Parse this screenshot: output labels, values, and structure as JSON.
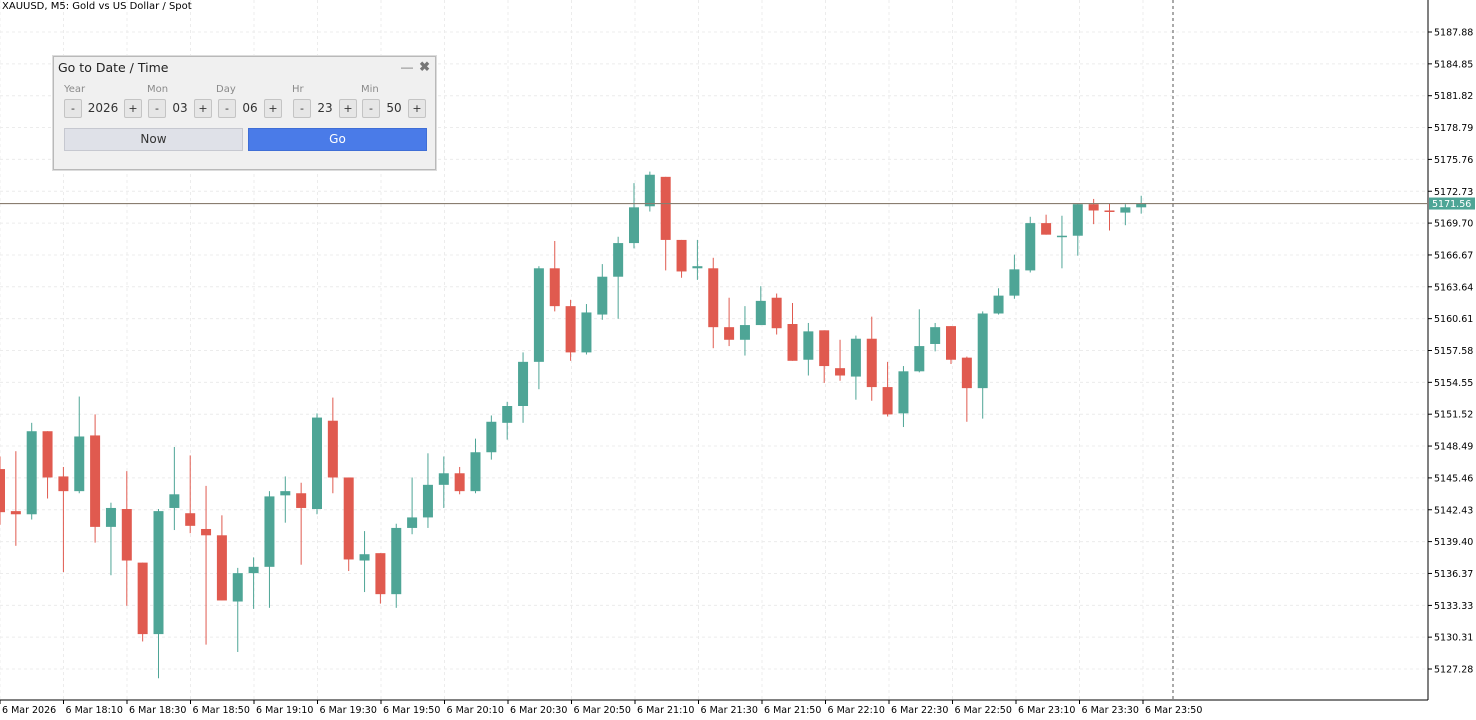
{
  "chart": {
    "title": "XAUUSD, M5:  Gold vs US Dollar / Spot",
    "current_price_label": "5171.56",
    "price_line_color": "#8a7e70",
    "bull_color": "#4ea596",
    "bear_color": "#e05a4f",
    "price_tag_color": "#4ea596"
  },
  "dialog": {
    "title": "Go to Date / Time",
    "minimize_icon": "minimize-icon",
    "close_icon": "close-icon",
    "fields": [
      {
        "label": "Year",
        "value": "2026",
        "dec": "-",
        "inc": "+"
      },
      {
        "label": "Mon",
        "value": "03",
        "dec": "-",
        "inc": "+"
      },
      {
        "label": "Day",
        "value": "06",
        "dec": "-",
        "inc": "+"
      },
      {
        "label": "Hr",
        "value": "23",
        "dec": "-",
        "inc": "+"
      },
      {
        "label": "Min",
        "value": "50",
        "dec": "-",
        "inc": "+"
      }
    ],
    "now_label": "Now",
    "go_label": "Go"
  },
  "chart_data": {
    "type": "candlestick",
    "y_ticks": [
      5187.88,
      5184.85,
      5181.82,
      5178.79,
      5175.76,
      5172.73,
      5169.7,
      5166.67,
      5163.64,
      5160.61,
      5157.58,
      5154.55,
      5151.52,
      5148.49,
      5145.46,
      5142.43,
      5139.4,
      5136.37,
      5133.33,
      5130.31,
      5127.28
    ],
    "x_tick_labels": [
      "6 Mar 2026",
      "6 Mar 18:10",
      "6 Mar 18:30",
      "6 Mar 18:50",
      "6 Mar 19:10",
      "6 Mar 19:30",
      "6 Mar 19:50",
      "6 Mar 20:10",
      "6 Mar 20:30",
      "6 Mar 20:50",
      "6 Mar 21:10",
      "6 Mar 21:30",
      "6 Mar 21:50",
      "6 Mar 22:10",
      "6 Mar 22:30",
      "6 Mar 22:50",
      "6 Mar 23:10",
      "6 Mar 23:30",
      "6 Mar 23:50"
    ],
    "ylim": [
      5124.8,
      5190.5
    ],
    "current_price": 5171.56,
    "grid": true,
    "candles": [
      {
        "o": 5146.3,
        "h": 5147.5,
        "l": 5141.0,
        "c": 5142.2
      },
      {
        "o": 5142.3,
        "h": 5148.0,
        "l": 5139.0,
        "c": 5142.0
      },
      {
        "o": 5142.0,
        "h": 5150.7,
        "l": 5141.5,
        "c": 5149.9
      },
      {
        "o": 5149.9,
        "h": 5149.9,
        "l": 5143.5,
        "c": 5145.5
      },
      {
        "o": 5145.6,
        "h": 5146.5,
        "l": 5136.5,
        "c": 5144.2
      },
      {
        "o": 5144.2,
        "h": 5153.2,
        "l": 5144.0,
        "c": 5149.4
      },
      {
        "o": 5149.5,
        "h": 5151.5,
        "l": 5139.3,
        "c": 5140.8
      },
      {
        "o": 5140.8,
        "h": 5143.1,
        "l": 5136.2,
        "c": 5142.6
      },
      {
        "o": 5142.5,
        "h": 5146.1,
        "l": 5133.3,
        "c": 5137.6
      },
      {
        "o": 5137.4,
        "h": 5137.4,
        "l": 5129.9,
        "c": 5130.6
      },
      {
        "o": 5130.6,
        "h": 5142.5,
        "l": 5126.4,
        "c": 5142.3
      },
      {
        "o": 5142.6,
        "h": 5148.4,
        "l": 5140.5,
        "c": 5143.9
      },
      {
        "o": 5142.1,
        "h": 5147.6,
        "l": 5140.2,
        "c": 5140.9
      },
      {
        "o": 5140.6,
        "h": 5144.7,
        "l": 5129.6,
        "c": 5140.0
      },
      {
        "o": 5140.0,
        "h": 5141.9,
        "l": 5133.8,
        "c": 5133.8
      },
      {
        "o": 5133.7,
        "h": 5136.9,
        "l": 5128.9,
        "c": 5136.4
      },
      {
        "o": 5136.4,
        "h": 5137.9,
        "l": 5133.0,
        "c": 5137.0
      },
      {
        "o": 5137.0,
        "h": 5144.2,
        "l": 5133.1,
        "c": 5143.7
      },
      {
        "o": 5143.8,
        "h": 5145.6,
        "l": 5141.2,
        "c": 5144.2
      },
      {
        "o": 5144.0,
        "h": 5145.0,
        "l": 5137.2,
        "c": 5142.6
      },
      {
        "o": 5142.5,
        "h": 5151.6,
        "l": 5142.0,
        "c": 5151.2
      },
      {
        "o": 5150.9,
        "h": 5153.1,
        "l": 5144.0,
        "c": 5145.5
      },
      {
        "o": 5145.5,
        "h": 5145.5,
        "l": 5136.6,
        "c": 5137.7
      },
      {
        "o": 5137.6,
        "h": 5140.4,
        "l": 5134.6,
        "c": 5138.2
      },
      {
        "o": 5138.3,
        "h": 5138.3,
        "l": 5133.5,
        "c": 5134.4
      },
      {
        "o": 5134.4,
        "h": 5141.1,
        "l": 5133.1,
        "c": 5140.7
      },
      {
        "o": 5140.7,
        "h": 5145.5,
        "l": 5140.1,
        "c": 5141.7
      },
      {
        "o": 5141.7,
        "h": 5147.8,
        "l": 5140.7,
        "c": 5144.8
      },
      {
        "o": 5144.8,
        "h": 5147.5,
        "l": 5142.6,
        "c": 5145.9
      },
      {
        "o": 5145.9,
        "h": 5146.5,
        "l": 5143.9,
        "c": 5144.2
      },
      {
        "o": 5144.2,
        "h": 5149.2,
        "l": 5144.0,
        "c": 5147.9
      },
      {
        "o": 5147.9,
        "h": 5151.4,
        "l": 5147.2,
        "c": 5150.8
      },
      {
        "o": 5150.7,
        "h": 5152.7,
        "l": 5149.1,
        "c": 5152.3
      },
      {
        "o": 5152.3,
        "h": 5157.4,
        "l": 5150.7,
        "c": 5156.5
      },
      {
        "o": 5156.5,
        "h": 5165.6,
        "l": 5153.9,
        "c": 5165.4
      },
      {
        "o": 5165.4,
        "h": 5168.0,
        "l": 5161.3,
        "c": 5161.8
      },
      {
        "o": 5161.8,
        "h": 5162.4,
        "l": 5156.6,
        "c": 5157.4
      },
      {
        "o": 5157.4,
        "h": 5162.0,
        "l": 5157.2,
        "c": 5161.2
      },
      {
        "o": 5161.0,
        "h": 5165.8,
        "l": 5160.5,
        "c": 5164.6
      },
      {
        "o": 5164.6,
        "h": 5168.4,
        "l": 5160.6,
        "c": 5167.8
      },
      {
        "o": 5167.8,
        "h": 5173.5,
        "l": 5167.3,
        "c": 5171.2
      },
      {
        "o": 5171.3,
        "h": 5174.6,
        "l": 5170.8,
        "c": 5174.3
      },
      {
        "o": 5174.1,
        "h": 5174.1,
        "l": 5165.2,
        "c": 5168.1
      },
      {
        "o": 5168.1,
        "h": 5168.1,
        "l": 5164.5,
        "c": 5165.1
      },
      {
        "o": 5165.4,
        "h": 5168.1,
        "l": 5164.3,
        "c": 5165.6
      },
      {
        "o": 5165.4,
        "h": 5166.4,
        "l": 5157.8,
        "c": 5159.8
      },
      {
        "o": 5159.8,
        "h": 5162.6,
        "l": 5158.0,
        "c": 5158.6
      },
      {
        "o": 5158.6,
        "h": 5161.8,
        "l": 5157.1,
        "c": 5160.0
      },
      {
        "o": 5160.0,
        "h": 5163.7,
        "l": 5160.0,
        "c": 5162.3
      },
      {
        "o": 5162.6,
        "h": 5163.0,
        "l": 5159.1,
        "c": 5159.7
      },
      {
        "o": 5160.1,
        "h": 5162.1,
        "l": 5156.6,
        "c": 5156.6
      },
      {
        "o": 5156.7,
        "h": 5160.2,
        "l": 5155.2,
        "c": 5159.4
      },
      {
        "o": 5159.5,
        "h": 5159.5,
        "l": 5154.5,
        "c": 5156.1
      },
      {
        "o": 5155.9,
        "h": 5158.6,
        "l": 5154.7,
        "c": 5155.2
      },
      {
        "o": 5155.1,
        "h": 5159.0,
        "l": 5152.9,
        "c": 5158.7
      },
      {
        "o": 5158.7,
        "h": 5160.8,
        "l": 5152.8,
        "c": 5154.1
      },
      {
        "o": 5154.1,
        "h": 5156.5,
        "l": 5151.3,
        "c": 5151.5
      },
      {
        "o": 5151.6,
        "h": 5156.1,
        "l": 5150.3,
        "c": 5155.6
      },
      {
        "o": 5155.6,
        "h": 5161.5,
        "l": 5155.5,
        "c": 5158.0
      },
      {
        "o": 5158.2,
        "h": 5160.2,
        "l": 5157.5,
        "c": 5159.8
      },
      {
        "o": 5159.9,
        "h": 5159.9,
        "l": 5156.3,
        "c": 5156.7
      },
      {
        "o": 5156.9,
        "h": 5157.0,
        "l": 5150.8,
        "c": 5154.0
      },
      {
        "o": 5154.0,
        "h": 5161.3,
        "l": 5151.1,
        "c": 5161.1
      },
      {
        "o": 5161.1,
        "h": 5163.5,
        "l": 5161.0,
        "c": 5162.8
      },
      {
        "o": 5162.8,
        "h": 5166.7,
        "l": 5162.5,
        "c": 5165.3
      },
      {
        "o": 5165.2,
        "h": 5170.3,
        "l": 5165.0,
        "c": 5169.7
      },
      {
        "o": 5169.7,
        "h": 5170.5,
        "l": 5168.6,
        "c": 5168.6
      },
      {
        "o": 5168.5,
        "h": 5170.4,
        "l": 5165.4,
        "c": 5168.5
      },
      {
        "o": 5168.5,
        "h": 5171.6,
        "l": 5166.6,
        "c": 5171.5
      },
      {
        "o": 5171.5,
        "h": 5172.0,
        "l": 5169.6,
        "c": 5170.9
      },
      {
        "o": 5170.9,
        "h": 5171.6,
        "l": 5169.0,
        "c": 5170.8
      },
      {
        "o": 5170.7,
        "h": 5171.5,
        "l": 5169.5,
        "c": 5171.2
      },
      {
        "o": 5171.2,
        "h": 5172.3,
        "l": 5170.6,
        "c": 5171.6
      }
    ]
  }
}
